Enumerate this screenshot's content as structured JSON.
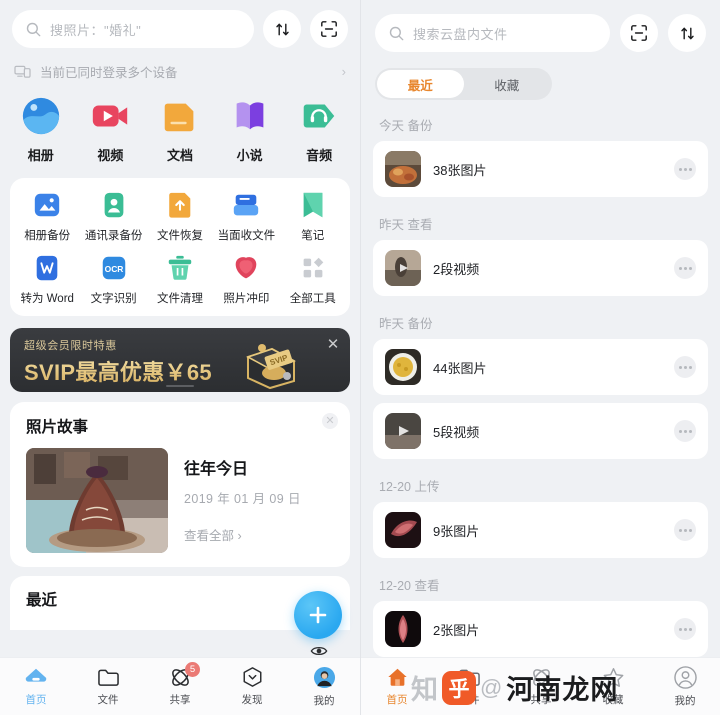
{
  "left": {
    "search": {
      "placeholder": "搜照片：\"婚礼\"",
      "icon": "search-icon"
    },
    "top_actions": [
      {
        "name": "sort-button",
        "icon": "sort-arrows-icon"
      },
      {
        "name": "scan-button",
        "icon": "scan-frame-icon"
      }
    ],
    "device_banner": {
      "text": "当前已同时登录多个设备",
      "icon": "devices-icon",
      "chevron": "›"
    },
    "apps": [
      {
        "label": "相册",
        "icon": "album-icon",
        "color": "#2f8ae0"
      },
      {
        "label": "视频",
        "icon": "video-icon",
        "color": "#e8455f"
      },
      {
        "label": "文档",
        "icon": "document-icon",
        "color": "#f2a83c"
      },
      {
        "label": "小说",
        "icon": "book-icon",
        "color": "#9a63e8"
      },
      {
        "label": "音频",
        "icon": "audio-icon",
        "color": "#3bbd95"
      }
    ],
    "tools_row1": [
      {
        "label": "相册备份",
        "icon": "photo-backup-icon",
        "color": "#3b82e8"
      },
      {
        "label": "通讯录备份",
        "icon": "contacts-backup-icon",
        "color": "#3bbd95"
      },
      {
        "label": "文件恢复",
        "icon": "file-restore-icon",
        "color": "#f2a83c"
      },
      {
        "label": "当面收文件",
        "icon": "receive-file-icon",
        "color": "#3b82e8"
      },
      {
        "label": "笔记",
        "icon": "note-icon",
        "color": "#3bbd95"
      }
    ],
    "tools_row2": [
      {
        "label": "转为 Word",
        "icon": "to-word-icon",
        "color": "#2f6fe0"
      },
      {
        "label": "文字识别",
        "icon": "ocr-icon",
        "color": "#2f8ae0"
      },
      {
        "label": "文件清理",
        "icon": "file-clean-icon",
        "color": "#3bbd95"
      },
      {
        "label": "照片冲印",
        "icon": "photo-print-icon",
        "color": "#e0445c"
      },
      {
        "label": "全部工具",
        "icon": "all-tools-icon",
        "color": "#c9ccd1"
      }
    ],
    "svip": {
      "subtitle": "超级会员限时特惠",
      "title": "SVIP最高优惠￥65",
      "chest_label": "SVIP",
      "close": "✕"
    },
    "story": {
      "card_title": "照片故事",
      "heading": "往年今日",
      "date": "2019 年 01 月 09 日",
      "more": "查看全部 ›",
      "close": "✕"
    },
    "recent_title": "最近",
    "fab": {
      "icon": "plus-icon",
      "label": "+"
    },
    "eye": {
      "icon": "eye-icon"
    },
    "tabs": [
      {
        "label": "首页",
        "icon": "home-cloud-icon",
        "active": true,
        "badge": ""
      },
      {
        "label": "文件",
        "icon": "folder-icon",
        "active": false,
        "badge": ""
      },
      {
        "label": "共享",
        "icon": "share-atom-icon",
        "active": false,
        "badge": "5"
      },
      {
        "label": "发现",
        "icon": "discover-icon",
        "active": false,
        "badge": ""
      },
      {
        "label": "我的",
        "icon": "avatar-icon",
        "active": false,
        "badge": ""
      }
    ]
  },
  "right": {
    "search": {
      "placeholder": "搜索云盘内文件",
      "icon": "search-icon"
    },
    "top_actions": [
      {
        "name": "scan-button",
        "icon": "scan-frame-icon"
      },
      {
        "name": "sort-button",
        "icon": "sort-arrows-icon"
      }
    ],
    "segments": [
      {
        "label": "最近",
        "active": true
      },
      {
        "label": "收藏",
        "active": false
      }
    ],
    "groups": [
      {
        "title": "今天 备份",
        "items": [
          {
            "name": "38张图片",
            "thumb": "food-thumb",
            "type": "image"
          }
        ]
      },
      {
        "title": "昨天 查看",
        "items": [
          {
            "name": "2段视频",
            "thumb": "person-thumb",
            "type": "video"
          }
        ]
      },
      {
        "title": "昨天 备份",
        "items": [
          {
            "name": "44张图片",
            "thumb": "dish-thumb",
            "type": "image"
          },
          {
            "name": "5段视频",
            "thumb": "dark-thumb",
            "type": "video"
          }
        ]
      },
      {
        "title": "12-20 上传",
        "items": [
          {
            "name": "9张图片",
            "thumb": "flower-thumb",
            "type": "image"
          }
        ]
      },
      {
        "title": "12-20 查看",
        "items": [
          {
            "name": "2张图片",
            "thumb": "flower2-thumb",
            "type": "image"
          }
        ]
      }
    ],
    "tabs": [
      {
        "label": "首页",
        "icon": "home-icon",
        "active": true
      },
      {
        "label": "文件",
        "icon": "folder-icon",
        "active": false
      },
      {
        "label": "共享",
        "icon": "share-atom-icon",
        "active": false
      },
      {
        "label": "收藏",
        "icon": "star-icon",
        "active": false
      },
      {
        "label": "我的",
        "icon": "avatar-icon",
        "active": false
      }
    ],
    "watermark": {
      "zhi": "知",
      "hu": "乎",
      "at": "@",
      "main": "河南龙网"
    }
  }
}
